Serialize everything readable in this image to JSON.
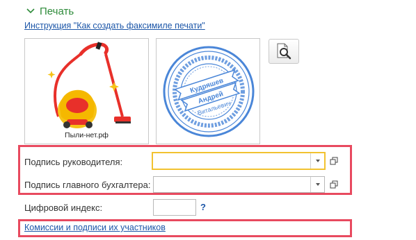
{
  "section": {
    "title": "Печать",
    "icon": "chevron-down-icon"
  },
  "instruction_link": "Инструкция \"Как создать факсимиле печати\"",
  "logo": {
    "caption": "Пыли-нет.рф",
    "icon": "vacuum-cleaner-logo"
  },
  "stamp": {
    "icon": "seal-stamp",
    "center_lines": [
      "Кудряшев",
      "Андрей",
      "Витальевич"
    ]
  },
  "preview_button": {
    "icon": "magnifier-icon"
  },
  "fields": {
    "director_signature": {
      "label": "Подпись руководителя:",
      "value": ""
    },
    "accountant_signature": {
      "label": "Подпись главного бухгалтера:",
      "value": ""
    },
    "digital_index": {
      "label": "Цифровой индекс:",
      "value": "",
      "help": "?"
    }
  },
  "commissions_link": "Комиссии и подписи их участников",
  "colors": {
    "header_green": "#2e8b3a",
    "link_blue": "#1c56a8",
    "highlight_red": "#e84a5f",
    "focus_yellow": "#f2c230",
    "stamp_blue": "#4a86d8",
    "logo_red": "#e8302a",
    "logo_yellow": "#f6c319"
  }
}
